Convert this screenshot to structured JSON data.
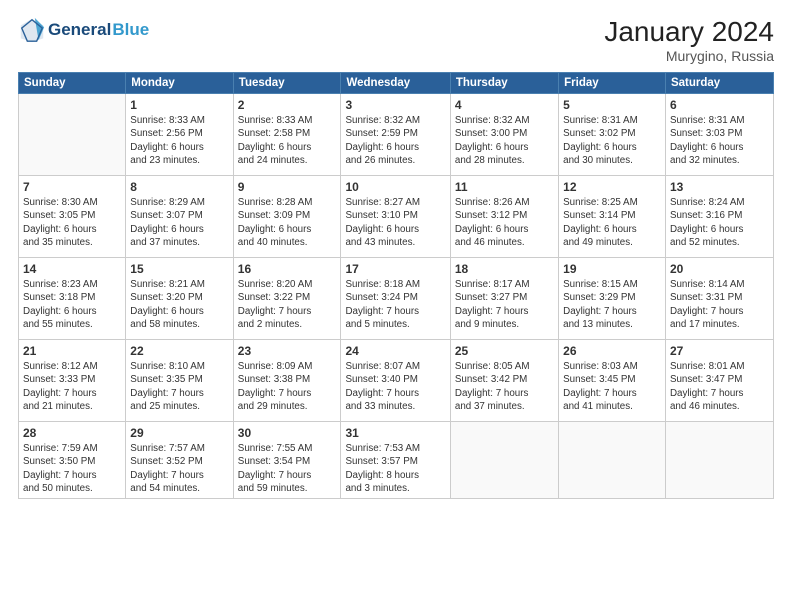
{
  "header": {
    "logo_line1": "General",
    "logo_line2": "Blue",
    "month_year": "January 2024",
    "location": "Murygino, Russia"
  },
  "weekdays": [
    "Sunday",
    "Monday",
    "Tuesday",
    "Wednesday",
    "Thursday",
    "Friday",
    "Saturday"
  ],
  "weeks": [
    [
      {
        "day": "",
        "info": ""
      },
      {
        "day": "1",
        "info": "Sunrise: 8:33 AM\nSunset: 2:56 PM\nDaylight: 6 hours\nand 23 minutes."
      },
      {
        "day": "2",
        "info": "Sunrise: 8:33 AM\nSunset: 2:58 PM\nDaylight: 6 hours\nand 24 minutes."
      },
      {
        "day": "3",
        "info": "Sunrise: 8:32 AM\nSunset: 2:59 PM\nDaylight: 6 hours\nand 26 minutes."
      },
      {
        "day": "4",
        "info": "Sunrise: 8:32 AM\nSunset: 3:00 PM\nDaylight: 6 hours\nand 28 minutes."
      },
      {
        "day": "5",
        "info": "Sunrise: 8:31 AM\nSunset: 3:02 PM\nDaylight: 6 hours\nand 30 minutes."
      },
      {
        "day": "6",
        "info": "Sunrise: 8:31 AM\nSunset: 3:03 PM\nDaylight: 6 hours\nand 32 minutes."
      }
    ],
    [
      {
        "day": "7",
        "info": "Sunrise: 8:30 AM\nSunset: 3:05 PM\nDaylight: 6 hours\nand 35 minutes."
      },
      {
        "day": "8",
        "info": "Sunrise: 8:29 AM\nSunset: 3:07 PM\nDaylight: 6 hours\nand 37 minutes."
      },
      {
        "day": "9",
        "info": "Sunrise: 8:28 AM\nSunset: 3:09 PM\nDaylight: 6 hours\nand 40 minutes."
      },
      {
        "day": "10",
        "info": "Sunrise: 8:27 AM\nSunset: 3:10 PM\nDaylight: 6 hours\nand 43 minutes."
      },
      {
        "day": "11",
        "info": "Sunrise: 8:26 AM\nSunset: 3:12 PM\nDaylight: 6 hours\nand 46 minutes."
      },
      {
        "day": "12",
        "info": "Sunrise: 8:25 AM\nSunset: 3:14 PM\nDaylight: 6 hours\nand 49 minutes."
      },
      {
        "day": "13",
        "info": "Sunrise: 8:24 AM\nSunset: 3:16 PM\nDaylight: 6 hours\nand 52 minutes."
      }
    ],
    [
      {
        "day": "14",
        "info": "Sunrise: 8:23 AM\nSunset: 3:18 PM\nDaylight: 6 hours\nand 55 minutes."
      },
      {
        "day": "15",
        "info": "Sunrise: 8:21 AM\nSunset: 3:20 PM\nDaylight: 6 hours\nand 58 minutes."
      },
      {
        "day": "16",
        "info": "Sunrise: 8:20 AM\nSunset: 3:22 PM\nDaylight: 7 hours\nand 2 minutes."
      },
      {
        "day": "17",
        "info": "Sunrise: 8:18 AM\nSunset: 3:24 PM\nDaylight: 7 hours\nand 5 minutes."
      },
      {
        "day": "18",
        "info": "Sunrise: 8:17 AM\nSunset: 3:27 PM\nDaylight: 7 hours\nand 9 minutes."
      },
      {
        "day": "19",
        "info": "Sunrise: 8:15 AM\nSunset: 3:29 PM\nDaylight: 7 hours\nand 13 minutes."
      },
      {
        "day": "20",
        "info": "Sunrise: 8:14 AM\nSunset: 3:31 PM\nDaylight: 7 hours\nand 17 minutes."
      }
    ],
    [
      {
        "day": "21",
        "info": "Sunrise: 8:12 AM\nSunset: 3:33 PM\nDaylight: 7 hours\nand 21 minutes."
      },
      {
        "day": "22",
        "info": "Sunrise: 8:10 AM\nSunset: 3:35 PM\nDaylight: 7 hours\nand 25 minutes."
      },
      {
        "day": "23",
        "info": "Sunrise: 8:09 AM\nSunset: 3:38 PM\nDaylight: 7 hours\nand 29 minutes."
      },
      {
        "day": "24",
        "info": "Sunrise: 8:07 AM\nSunset: 3:40 PM\nDaylight: 7 hours\nand 33 minutes."
      },
      {
        "day": "25",
        "info": "Sunrise: 8:05 AM\nSunset: 3:42 PM\nDaylight: 7 hours\nand 37 minutes."
      },
      {
        "day": "26",
        "info": "Sunrise: 8:03 AM\nSunset: 3:45 PM\nDaylight: 7 hours\nand 41 minutes."
      },
      {
        "day": "27",
        "info": "Sunrise: 8:01 AM\nSunset: 3:47 PM\nDaylight: 7 hours\nand 46 minutes."
      }
    ],
    [
      {
        "day": "28",
        "info": "Sunrise: 7:59 AM\nSunset: 3:50 PM\nDaylight: 7 hours\nand 50 minutes."
      },
      {
        "day": "29",
        "info": "Sunrise: 7:57 AM\nSunset: 3:52 PM\nDaylight: 7 hours\nand 54 minutes."
      },
      {
        "day": "30",
        "info": "Sunrise: 7:55 AM\nSunset: 3:54 PM\nDaylight: 7 hours\nand 59 minutes."
      },
      {
        "day": "31",
        "info": "Sunrise: 7:53 AM\nSunset: 3:57 PM\nDaylight: 8 hours\nand 3 minutes."
      },
      {
        "day": "",
        "info": ""
      },
      {
        "day": "",
        "info": ""
      },
      {
        "day": "",
        "info": ""
      }
    ]
  ]
}
